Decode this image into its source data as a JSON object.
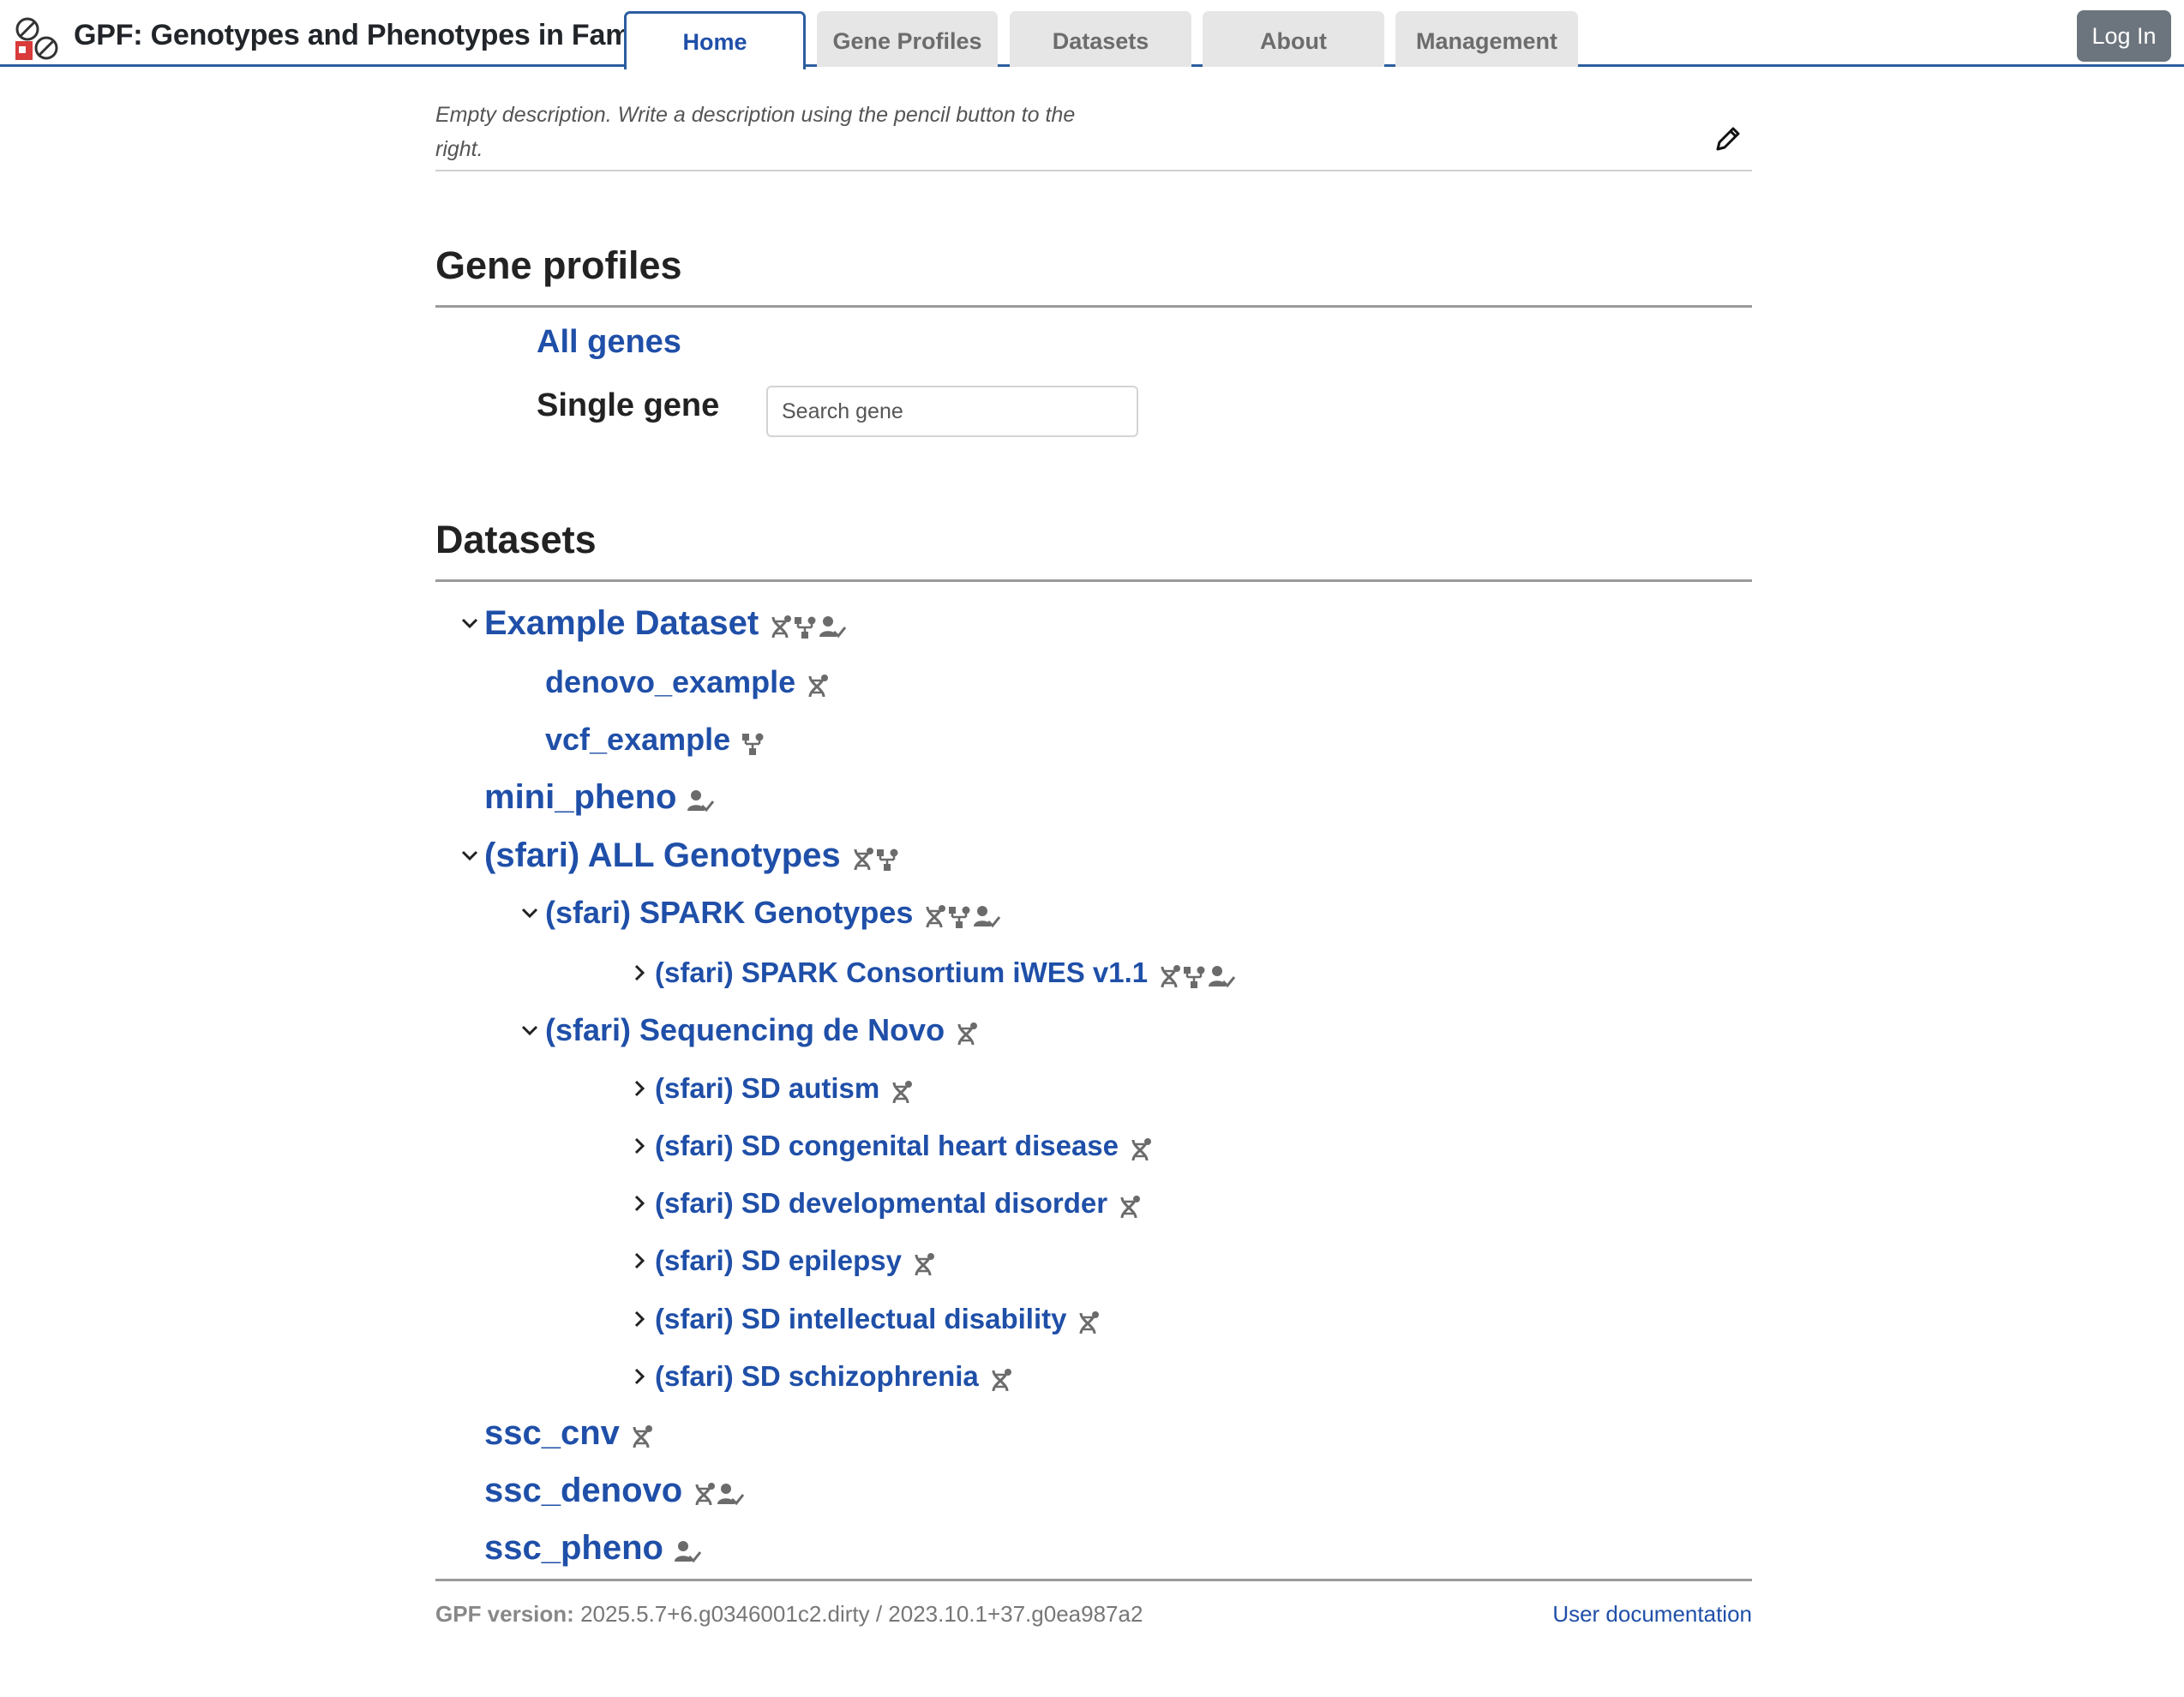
{
  "app": {
    "title": "GPF: Genotypes and Phenotypes in Families"
  },
  "nav": {
    "tabs": [
      {
        "label": "Home",
        "active": true
      },
      {
        "label": "Gene Profiles",
        "active": false
      },
      {
        "label": "Datasets",
        "active": false
      },
      {
        "label": "About",
        "active": false
      },
      {
        "label": "Management",
        "active": false
      }
    ],
    "login_label": "Log In"
  },
  "home": {
    "description": "Empty description. Write a description using the pencil button to the right."
  },
  "gene_profiles": {
    "heading": "Gene profiles",
    "all_genes_label": "All genes",
    "single_gene_label": "Single gene",
    "search_placeholder": "Search gene"
  },
  "datasets": {
    "heading": "Datasets",
    "items": [
      {
        "name": "Example Dataset",
        "level": 0,
        "toggle": "expanded",
        "icons": [
          "dna-icon",
          "pedigree-icon",
          "phenotype-icon"
        ]
      },
      {
        "name": "denovo_example",
        "level": 1,
        "toggle": "none",
        "icons": [
          "dna-icon"
        ]
      },
      {
        "name": "vcf_example",
        "level": 1,
        "toggle": "none",
        "icons": [
          "pedigree-icon"
        ]
      },
      {
        "name": "mini_pheno",
        "level": 0,
        "toggle": "none",
        "icons": [
          "phenotype-icon"
        ]
      },
      {
        "name": "(sfari) ALL Genotypes",
        "level": 0,
        "toggle": "expanded",
        "icons": [
          "dna-icon",
          "pedigree-icon"
        ]
      },
      {
        "name": "(sfari) SPARK Genotypes",
        "level": 1,
        "toggle": "expanded",
        "icons": [
          "dna-icon",
          "pedigree-icon",
          "phenotype-icon"
        ]
      },
      {
        "name": "(sfari) SPARK Consortium iWES v1.1",
        "level": 2,
        "toggle": "collapsed",
        "icons": [
          "dna-icon",
          "pedigree-icon",
          "phenotype-icon"
        ]
      },
      {
        "name": "(sfari) Sequencing de Novo",
        "level": 1,
        "toggle": "expanded",
        "icons": [
          "dna-icon"
        ]
      },
      {
        "name": "(sfari) SD autism",
        "level": 2,
        "toggle": "collapsed",
        "icons": [
          "dna-icon"
        ]
      },
      {
        "name": "(sfari) SD congenital heart disease",
        "level": 2,
        "toggle": "collapsed",
        "icons": [
          "dna-icon"
        ]
      },
      {
        "name": "(sfari) SD developmental disorder",
        "level": 2,
        "toggle": "collapsed",
        "icons": [
          "dna-icon"
        ]
      },
      {
        "name": "(sfari) SD epilepsy",
        "level": 2,
        "toggle": "collapsed",
        "icons": [
          "dna-icon"
        ]
      },
      {
        "name": "(sfari) SD intellectual disability",
        "level": 2,
        "toggle": "collapsed",
        "icons": [
          "dna-icon"
        ]
      },
      {
        "name": "(sfari) SD schizophrenia",
        "level": 2,
        "toggle": "collapsed",
        "icons": [
          "dna-icon"
        ]
      },
      {
        "name": "ssc_cnv",
        "level": 0,
        "toggle": "none",
        "icons": [
          "dna-icon"
        ]
      },
      {
        "name": "ssc_denovo",
        "level": 0,
        "toggle": "none",
        "icons": [
          "dna-icon",
          "phenotype-icon"
        ]
      },
      {
        "name": "ssc_pheno",
        "level": 0,
        "toggle": "none",
        "icons": [
          "phenotype-icon"
        ]
      }
    ]
  },
  "footer": {
    "version_label": "GPF version:",
    "version_value": "2025.5.7+6.g0346001c2.dirty / 2023.10.1+37.g0ea987a2",
    "docs_link": "User documentation"
  },
  "colors": {
    "link": "#1f4fa8",
    "nav_border": "#2c5d9e",
    "login_bg": "#6c757d"
  }
}
